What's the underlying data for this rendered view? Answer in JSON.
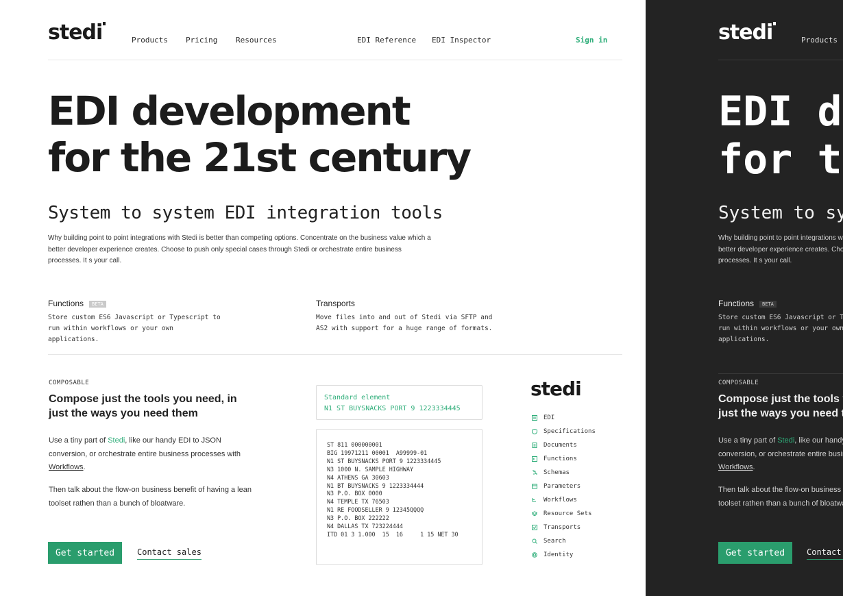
{
  "brand": {
    "name": "stedi",
    "accent": "#2fae7a",
    "button_bg": "#2a9d6d",
    "dark_bg": "#232323"
  },
  "nav": {
    "products": "Products",
    "pricing": "Pricing",
    "resources": "Resources",
    "edi_reference": "EDI Reference",
    "edi_inspector": "EDI Inspector",
    "sign_in": "Sign in"
  },
  "hero": {
    "line1": "EDI development",
    "line2": "for the 21st century",
    "subtitle": "System to system EDI integration tools",
    "intro": "Why building point to point integrations with Stedi is better than competing options. Concentrate on the business value which a better developer experience creates. Choose to push only special cases through Stedi or orchestrate entire business processes. It  s your call."
  },
  "features": {
    "functions": {
      "title": "Functions",
      "badge": "BETA",
      "desc": "Store custom ES6 Javascript or Typescript to run within workflows or your own applications."
    },
    "transports": {
      "title": "Transports",
      "desc": "Move files into and out of Stedi via SFTP and AS2 with support for a huge range of formats."
    }
  },
  "composable": {
    "eyebrow": "COMPOSABLE",
    "heading": "Compose just the tools you need, in just the ways you need them",
    "p1_pre": "Use a tiny part of ",
    "p1_link": "Stedi",
    "p1_mid": ", like our handy EDI to JSON conversion, or orchestrate entire business processes with ",
    "p1_link2": "Workflows",
    "p1_end": ".",
    "p2": "Then talk about the flow-on business benefit of having a lean toolset rathen than a bunch of bloatware.",
    "cta_primary": "Get started",
    "cta_secondary": "Contact sales"
  },
  "standard_element": {
    "label": "Standard element",
    "value": "N1 ST BUYSNACKS PORT 9 1223334445"
  },
  "edi_code": [
    "ST 811 000000001",
    "BIG 19971211 00001  A99999-01",
    "N1 ST BUYSNACKS PORT 9 1223334445",
    "N3 1000 N. SAMPLE HIGHWAY",
    "N4 ATHENS GA 30603",
    "N1 BT BUYSNACKS 9 1223334444",
    "N3 P.O. BOX 0000",
    "N4 TEMPLE TX 76503",
    "N1 RE FOODSELLER 9 12345QQQQ",
    "N3 P.O. BOX 222222",
    "N4 DALLAS TX 723224444",
    "ITD 01 3 1.000  15  16     1 15 NET 30"
  ],
  "side_menu": [
    {
      "label": "EDI",
      "icon": "edi-icon"
    },
    {
      "label": "Specifications",
      "icon": "shield-icon"
    },
    {
      "label": "Documents",
      "icon": "document-icon"
    },
    {
      "label": "Functions",
      "icon": "terminal-icon"
    },
    {
      "label": "Schemas",
      "icon": "schema-icon"
    },
    {
      "label": "Parameters",
      "icon": "parameters-icon"
    },
    {
      "label": "Workflows",
      "icon": "workflow-icon"
    },
    {
      "label": "Resource Sets",
      "icon": "layers-icon"
    },
    {
      "label": "Transports",
      "icon": "transport-icon"
    },
    {
      "label": "Search",
      "icon": "search-icon"
    },
    {
      "label": "Identity",
      "icon": "fingerprint-icon"
    }
  ]
}
